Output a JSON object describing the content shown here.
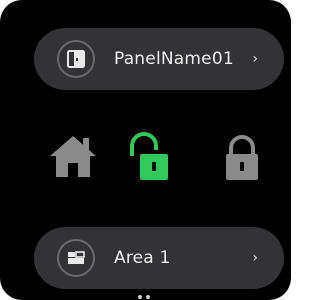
{
  "panel": {
    "label": "PanelName01",
    "icon": "panel-door-icon",
    "chevron": "›"
  },
  "modes": [
    {
      "name": "home",
      "icon": "home-icon",
      "state": "inactive",
      "color": "#8a8a8a"
    },
    {
      "name": "unlocked",
      "icon": "unlocked-padlock-icon",
      "state": "active",
      "color": "#34c759"
    },
    {
      "name": "locked",
      "icon": "locked-padlock-icon",
      "state": "inactive",
      "color": "#8a8a8a"
    }
  ],
  "area": {
    "label": "Area 1",
    "icon": "area-floorplan-icon",
    "chevron": "›"
  },
  "colors": {
    "background": "#000000",
    "pill": "#333335",
    "active_accent": "#34c759",
    "inactive": "#8a8a8a"
  }
}
